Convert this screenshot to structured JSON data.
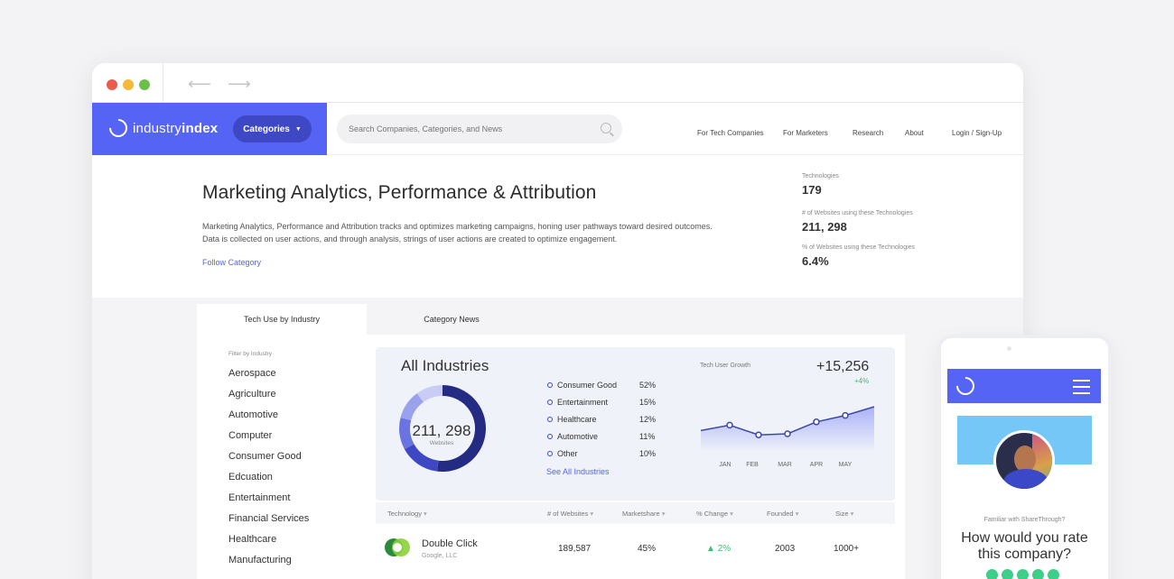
{
  "nav": {
    "logo_prefix": "industry",
    "logo_suffix": "index",
    "categories_label": "Categories",
    "search_placeholder": "Search Companies, Categories, and News",
    "links": [
      "For Tech Companies",
      "For Marketers",
      "Research",
      "About",
      "Login / Sign-Up"
    ]
  },
  "category": {
    "title": "Marketing Analytics, Performance & Attribution",
    "description": "Marketing Analytics, Performance and Attribution tracks and optimizes marketing campaigns, honing user pathways toward desired outcomes. Data is collected on user actions, and through analysis, strings of user actions are created to optimize engagement.",
    "follow_label": "Follow Category"
  },
  "stats": [
    {
      "label": "Technologies",
      "value": "179"
    },
    {
      "label": "# of Websites using these Technologies",
      "value": "211, 298"
    },
    {
      "label": "% of Websites using these Technologies",
      "value": "6.4%"
    }
  ],
  "tabs": [
    "Tech Use by Industry",
    "Category News"
  ],
  "filter": {
    "label": "Filter by Industry",
    "industries": [
      "Aerospace",
      "Agriculture",
      "Automotive",
      "Computer",
      "Consumer Good",
      "Edcuation",
      "Entertainment",
      "Financial Services",
      "Healthcare",
      "Manufacturing"
    ]
  },
  "summary": {
    "title": "All Industries",
    "donut_value": "211, 298",
    "donut_sub": "Websites",
    "see_all": "See All Industries",
    "legend": [
      {
        "name": "Consumer Good",
        "pct": "52%",
        "value": 52
      },
      {
        "name": "Entertainment",
        "pct": "15%",
        "value": 15
      },
      {
        "name": "Healthcare",
        "pct": "12%",
        "value": 12
      },
      {
        "name": "Automotive",
        "pct": "11%",
        "value": 11
      },
      {
        "name": "Other",
        "pct": "10%",
        "value": 10
      }
    ],
    "colors": [
      "#232b83",
      "#3e48c5",
      "#6a74e0",
      "#9aa2ee",
      "#c9cdf6"
    ]
  },
  "growth": {
    "label": "Tech User Growth",
    "value": "+15,256",
    "delta": "+4%"
  },
  "chart_data": {
    "type": "line",
    "title": "Tech User Growth",
    "categories": [
      "JAN",
      "FEB",
      "MAR",
      "APR",
      "MAY"
    ],
    "series": [
      {
        "values": [
          48,
          53,
          44,
          45,
          56,
          62,
          70
        ]
      }
    ],
    "ylim": [
      30,
      80
    ],
    "grid": false
  },
  "table": {
    "headers": [
      "Technology",
      "# of Websites",
      "Marketshare",
      "% Change",
      "Founded",
      "Size"
    ],
    "rows": [
      {
        "name": "Double Click",
        "company": "Google, LLC",
        "websites": "189,587",
        "marketshare": "45%",
        "change": "2%",
        "founded": "2003",
        "size": "1000+"
      }
    ]
  },
  "mobile": {
    "question_small": "Familiar with ShareThrough?",
    "question": "How would you rate this company?"
  }
}
